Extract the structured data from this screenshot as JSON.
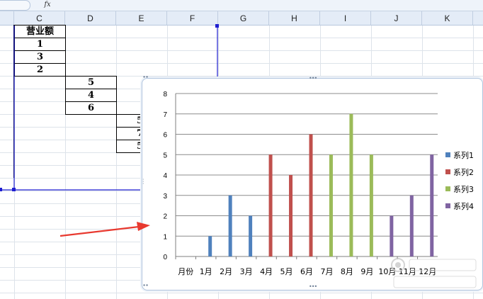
{
  "formula_bar": {
    "fx_label": "fx"
  },
  "columns": [
    {
      "id": "c",
      "label": "C"
    },
    {
      "id": "d",
      "label": "D"
    },
    {
      "id": "e",
      "label": "E"
    },
    {
      "id": "f",
      "label": "F"
    },
    {
      "id": "g",
      "label": "G"
    },
    {
      "id": "h",
      "label": "H"
    },
    {
      "id": "i",
      "label": "I"
    },
    {
      "id": "j",
      "label": "J"
    },
    {
      "id": "k",
      "label": "K"
    }
  ],
  "cells": {
    "c_header": "营业额",
    "c_values": [
      "1",
      "3",
      "2"
    ],
    "d_values": [
      "5",
      "4",
      "6"
    ],
    "e_values": [
      "5",
      "7",
      "5"
    ]
  },
  "chart_data": {
    "type": "bar",
    "categories": [
      "月份",
      "1月",
      "2月",
      "3月",
      "4月",
      "5月",
      "6月",
      "7月",
      "8月",
      "9月",
      "10月",
      "11月",
      "12月"
    ],
    "series": [
      {
        "name": "系列1",
        "color": "#4f81bd",
        "values": [
          null,
          1,
          3,
          2,
          null,
          null,
          null,
          null,
          null,
          null,
          null,
          null,
          null
        ]
      },
      {
        "name": "系列2",
        "color": "#c0504d",
        "values": [
          null,
          null,
          null,
          null,
          5,
          4,
          6,
          null,
          null,
          null,
          null,
          null,
          null
        ]
      },
      {
        "name": "系列3",
        "color": "#9bbb59",
        "values": [
          null,
          null,
          null,
          null,
          null,
          null,
          null,
          5,
          7,
          5,
          null,
          null,
          null
        ]
      },
      {
        "name": "系列4",
        "color": "#8064a2",
        "values": [
          null,
          null,
          null,
          null,
          null,
          null,
          null,
          null,
          null,
          null,
          2,
          3,
          5
        ]
      }
    ],
    "y_ticks": [
      "0",
      "1",
      "2",
      "3",
      "4",
      "5",
      "6",
      "7",
      "8"
    ],
    "ylim": [
      0,
      8
    ],
    "grid": true,
    "legend_position": "right"
  },
  "colors": {
    "selection_line": "#1f1fd0",
    "annotation_arrow": "#e8392f",
    "chart_border": "#b0c4de"
  }
}
